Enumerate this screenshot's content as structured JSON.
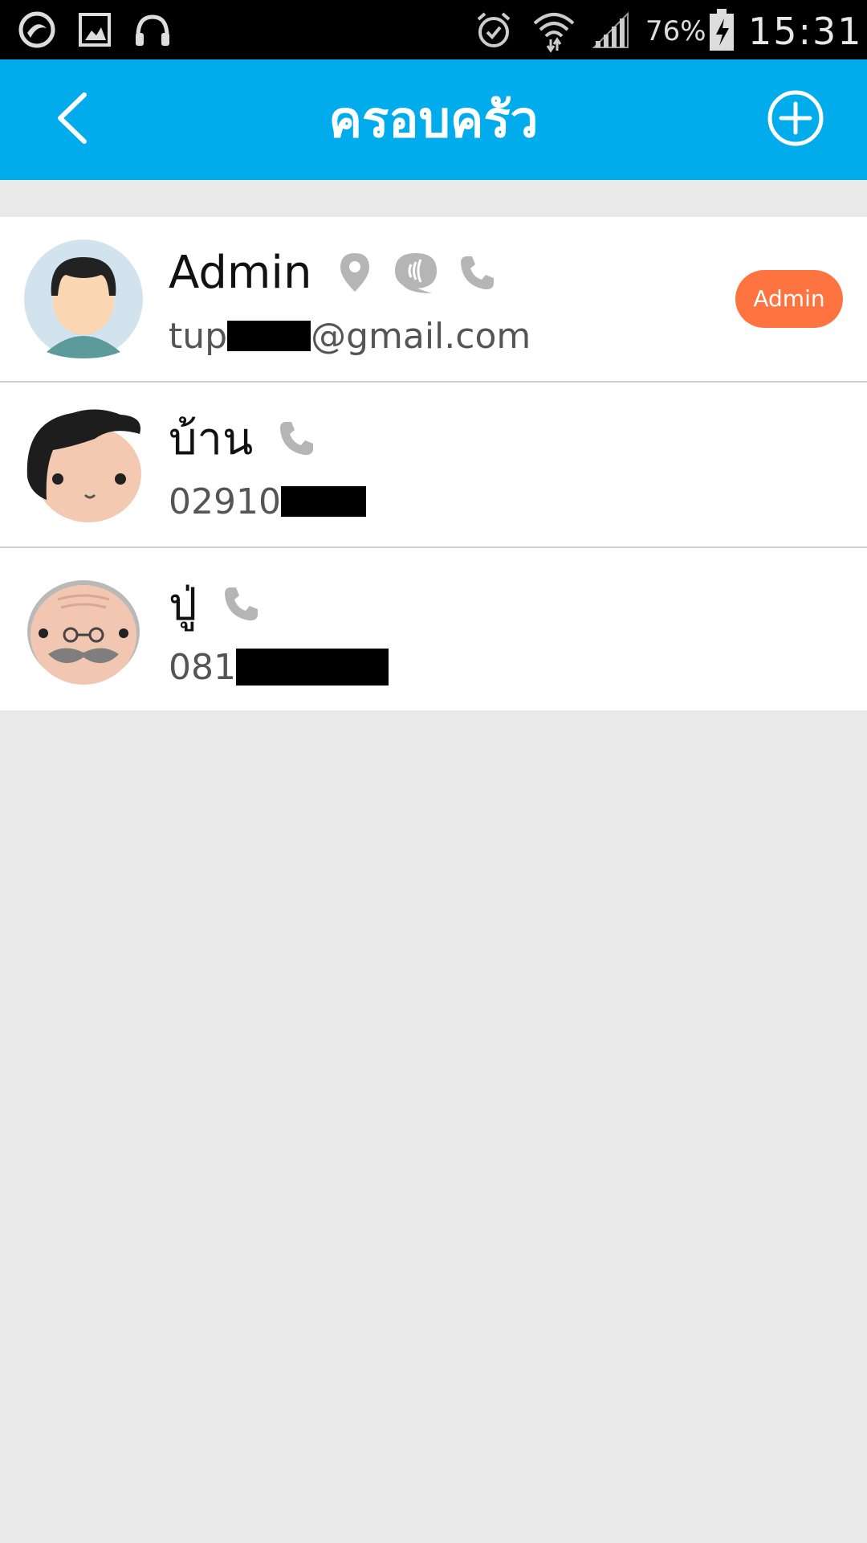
{
  "status_bar": {
    "battery_percent": "76%",
    "time": "15:31",
    "icons": [
      "app-notification-icon",
      "gallery-icon",
      "headphones-icon",
      "alarm-icon",
      "wifi-icon",
      "signal-icon",
      "battery-charging-icon"
    ]
  },
  "header": {
    "title": "ครอบครัว",
    "back_icon": "chevron-left-icon",
    "add_icon": "add-circle-icon",
    "background_color": "#00acec"
  },
  "members": [
    {
      "name": "Admin",
      "sub_prefix": "tup",
      "sub_suffix": "@gmail.com",
      "badge": "Admin",
      "avatar": "boy-avatar",
      "icons": [
        "location-icon",
        "chat-icon",
        "phone-icon"
      ]
    },
    {
      "name": "บ้าน",
      "sub_prefix": "02910",
      "sub_suffix": "",
      "avatar": "man-avatar",
      "icons": [
        "phone-icon"
      ]
    },
    {
      "name": "ปู่",
      "sub_prefix": "081",
      "sub_suffix": "",
      "avatar": "grandfather-avatar",
      "icons": [
        "phone-icon"
      ]
    }
  ],
  "colors": {
    "accent": "#00acec",
    "badge": "#fe7440",
    "background": "#e9e9e9"
  }
}
